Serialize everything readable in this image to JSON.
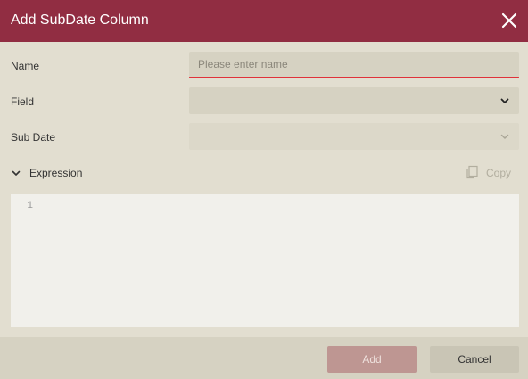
{
  "dialog": {
    "title": "Add SubDate Column",
    "close_icon": "close-icon"
  },
  "form": {
    "name": {
      "label": "Name",
      "value": "",
      "placeholder": "Please enter name"
    },
    "field": {
      "label": "Field",
      "value": ""
    },
    "sub_date": {
      "label": "Sub Date",
      "value": ""
    }
  },
  "expression": {
    "label": "Expression",
    "toggle_icon": "chevron-down-icon",
    "copy_label": "Copy",
    "copy_icon": "copy-icon",
    "line_numbers": [
      "1"
    ],
    "code": ""
  },
  "footer": {
    "add_label": "Add",
    "cancel_label": "Cancel"
  },
  "colors": {
    "titlebar": "#912d42",
    "error_underline": "#e0323a",
    "primary_button_disabled": "#be9692"
  }
}
